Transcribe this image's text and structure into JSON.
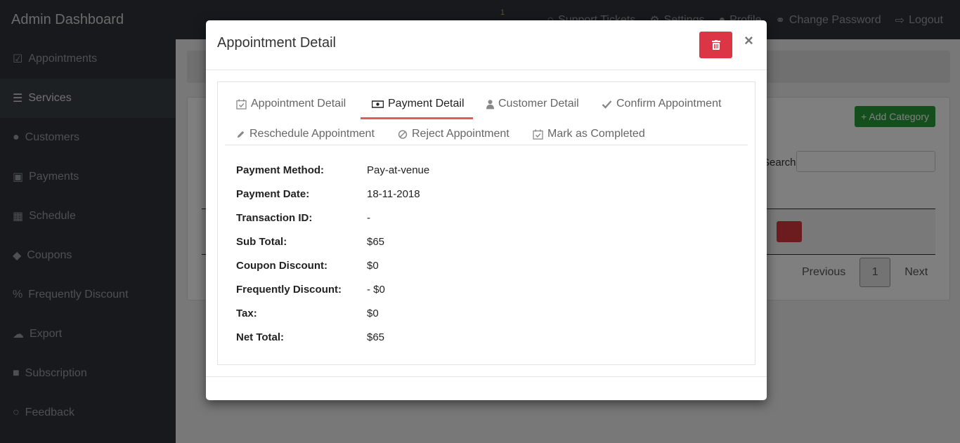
{
  "app": {
    "brand": "Admin Dashboard",
    "topnav": [
      {
        "label": "Support Tickets",
        "icon": "comment-icon"
      },
      {
        "label": "Settings",
        "icon": "gear-icon"
      },
      {
        "label": "Profile",
        "icon": "user-icon"
      },
      {
        "label": "Change Password",
        "icon": "key-icon"
      },
      {
        "label": "Logout",
        "icon": "logout-icon"
      }
    ],
    "notification_count": "1"
  },
  "sidebar": {
    "items": [
      {
        "label": "Appointments",
        "icon": "calendar-check-icon"
      },
      {
        "label": "Services",
        "icon": "list-icon",
        "active": true
      },
      {
        "label": "Customers",
        "icon": "users-icon"
      },
      {
        "label": "Payments",
        "icon": "money-icon"
      },
      {
        "label": "Schedule",
        "icon": "calendar-icon"
      },
      {
        "label": "Coupons",
        "icon": "tag-icon"
      },
      {
        "label": "Frequently Discount",
        "icon": "percent-icon"
      },
      {
        "label": "Export",
        "icon": "cloud-download-icon"
      },
      {
        "label": "Subscription",
        "icon": "lock-icon"
      },
      {
        "label": "Feedback",
        "icon": "comments-icon"
      }
    ]
  },
  "main": {
    "add_category_label": "Add Category",
    "search_label": "Search:",
    "pager": {
      "previous": "Previous",
      "page": "1",
      "next": "Next"
    }
  },
  "modal": {
    "title": "Appointment Detail",
    "close": "×",
    "tabs": [
      {
        "label": "Appointment Detail",
        "icon": "calendar-check-icon"
      },
      {
        "label": "Payment Detail",
        "icon": "money-icon",
        "active": true
      },
      {
        "label": "Customer Detail",
        "icon": "user-icon"
      },
      {
        "label": "Confirm Appointment",
        "icon": "check-icon"
      },
      {
        "label": "Reschedule Appointment",
        "icon": "pencil-icon"
      },
      {
        "label": "Reject Appointment",
        "icon": "ban-icon"
      },
      {
        "label": "Mark as Completed",
        "icon": "calendar-check-icon"
      }
    ],
    "details": [
      {
        "label": "Payment Method:",
        "value": "Pay-at-venue"
      },
      {
        "label": "Payment Date:",
        "value": "18-11-2018"
      },
      {
        "label": "Transaction ID:",
        "value": "-"
      },
      {
        "label": "Sub Total:",
        "value": "$65"
      },
      {
        "label": "Coupon Discount:",
        "value": "$0"
      },
      {
        "label": "Frequently Discount:",
        "value": "- $0"
      },
      {
        "label": "Tax:",
        "value": "$0"
      },
      {
        "label": "Net Total:",
        "value": "$65"
      }
    ]
  },
  "colors": {
    "danger": "#dc3545",
    "success": "#2a9d3a",
    "active_tab_underline": "#e05c5c",
    "sidebar_bg": "#2e3338"
  }
}
